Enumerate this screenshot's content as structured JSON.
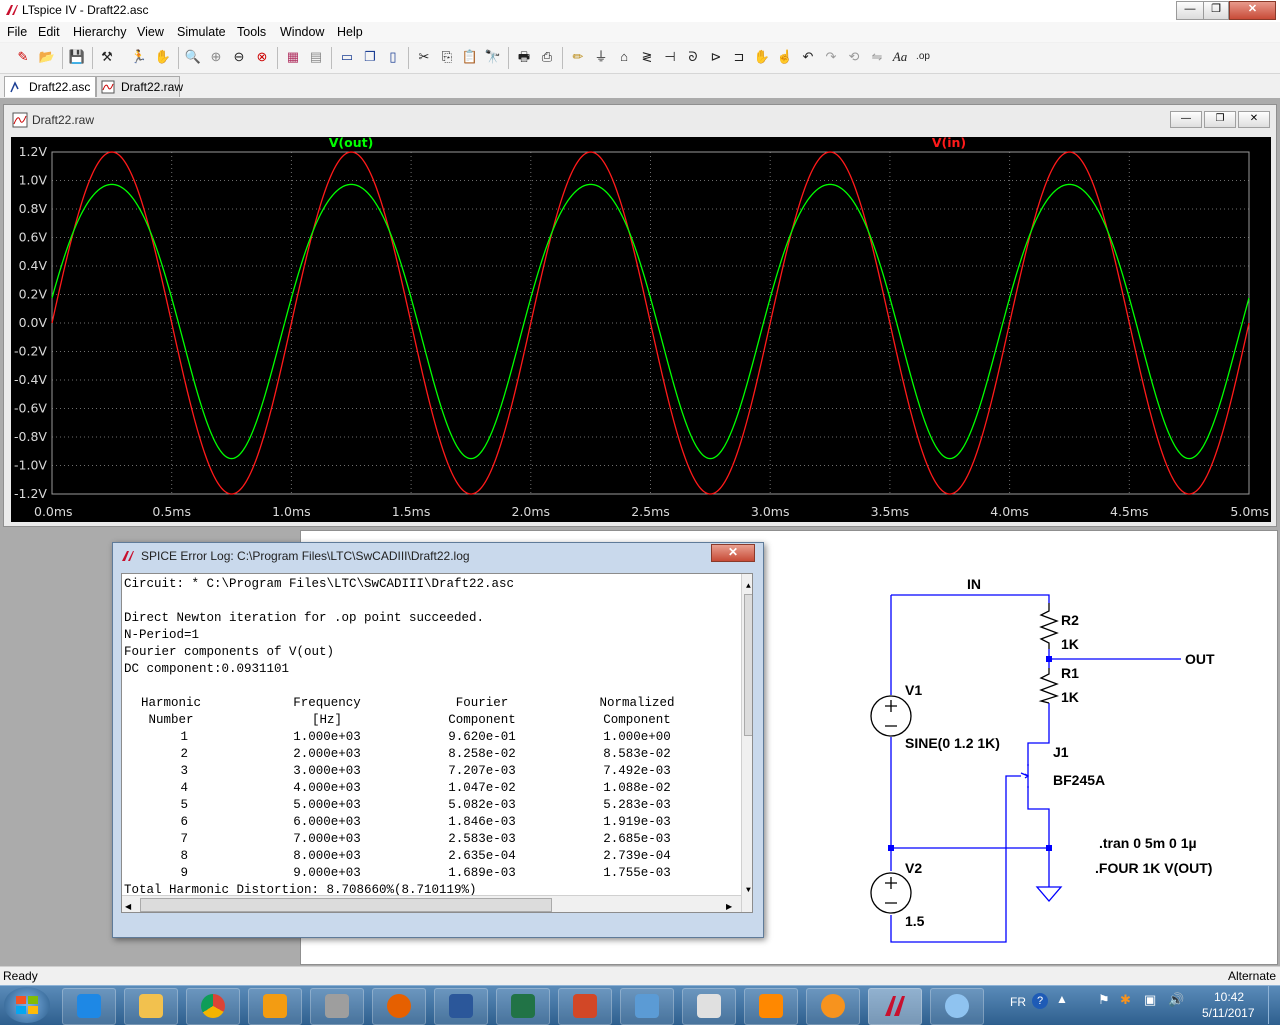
{
  "window": {
    "title": "LTspice IV - Draft22.asc",
    "min": "—",
    "restore": "❐",
    "close": "✕"
  },
  "menu": [
    "File",
    "Edit",
    "Hierarchy",
    "View",
    "Simulate",
    "Tools",
    "Window",
    "Help"
  ],
  "tabs": [
    {
      "label": "Draft22.asc"
    },
    {
      "label": "Draft22.raw"
    }
  ],
  "plot_window": {
    "title": "Draft22.raw",
    "btn_min": "—",
    "btn_restore": "❐",
    "btn_close": "✕"
  },
  "chart_data": {
    "type": "line",
    "xlim": [
      0,
      5
    ],
    "ylim": [
      -1.2,
      1.2
    ],
    "x_unit": "ms",
    "y_unit": "V",
    "xticks": [
      "0.0ms",
      "0.5ms",
      "1.0ms",
      "1.5ms",
      "2.0ms",
      "2.5ms",
      "3.0ms",
      "3.5ms",
      "4.0ms",
      "4.5ms",
      "5.0ms"
    ],
    "yticks": [
      "1.2V",
      "1.0V",
      "0.8V",
      "0.6V",
      "0.4V",
      "0.2V",
      "0.0V",
      "-0.2V",
      "-0.4V",
      "-0.6V",
      "-0.8V",
      "-1.0V",
      "-1.2V"
    ],
    "grid": true,
    "series": [
      {
        "name": "V(out)",
        "color": "#00ff00",
        "frequency_hz": 1000,
        "dc": 0.0931101,
        "fundamental": 0.962,
        "h2": 0.08258
      },
      {
        "name": "V(in)",
        "color": "#ff1a1a",
        "frequency_hz": 1000,
        "dc": 0,
        "amplitude": 1.2
      }
    ]
  },
  "log": {
    "title": "SPICE Error Log: C:\\Program Files\\LTC\\SwCADIII\\Draft22.log",
    "lines": [
      "Circuit: * C:\\Program Files\\LTC\\SwCADIII\\Draft22.asc",
      "",
      "Direct Newton iteration for .op point succeeded.",
      "N-Period=1",
      "Fourier components of V(out)",
      "DC component:0.0931101"
    ],
    "headers": [
      [
        "Harmonic",
        "Frequency",
        "Fourier",
        "Normalized"
      ],
      [
        "Number",
        "[Hz]",
        "Component",
        "Component"
      ]
    ],
    "rows": [
      [
        "1",
        "1.000e+03",
        "9.620e-01",
        "1.000e+00"
      ],
      [
        "2",
        "2.000e+03",
        "8.258e-02",
        "8.583e-02"
      ],
      [
        "3",
        "3.000e+03",
        "7.207e-03",
        "7.492e-03"
      ],
      [
        "4",
        "4.000e+03",
        "1.047e-02",
        "1.088e-02"
      ],
      [
        "5",
        "5.000e+03",
        "5.082e-03",
        "5.283e-03"
      ],
      [
        "6",
        "6.000e+03",
        "1.846e-03",
        "1.919e-03"
      ],
      [
        "7",
        "7.000e+03",
        "2.583e-03",
        "2.685e-03"
      ],
      [
        "8",
        "8.000e+03",
        "2.635e-04",
        "2.739e-04"
      ],
      [
        "9",
        "9.000e+03",
        "1.689e-03",
        "1.755e-03"
      ]
    ],
    "thd": "Total Harmonic Distortion: 8.708660%(8.710119%)",
    "close": "✕"
  },
  "schematic": {
    "net_in": "IN",
    "net_out": "OUT",
    "r2": "R2",
    "r2_val": "1K",
    "r1": "R1",
    "r1_val": "1K",
    "v1": "V1",
    "v1_val": "SINE(0 1.2 1K)",
    "v2": "V2",
    "v2_val": "1.5",
    "j1": "J1",
    "j1_val": "BF245A",
    "directive1": ".tran 0 5m 0 1µ",
    "directive2": ".FOUR 1K V(OUT)"
  },
  "status": {
    "left": "Ready",
    "right": "Alternate"
  },
  "taskbar": {
    "lang": "FR",
    "time": "10:42",
    "date": "5/11/2017"
  }
}
